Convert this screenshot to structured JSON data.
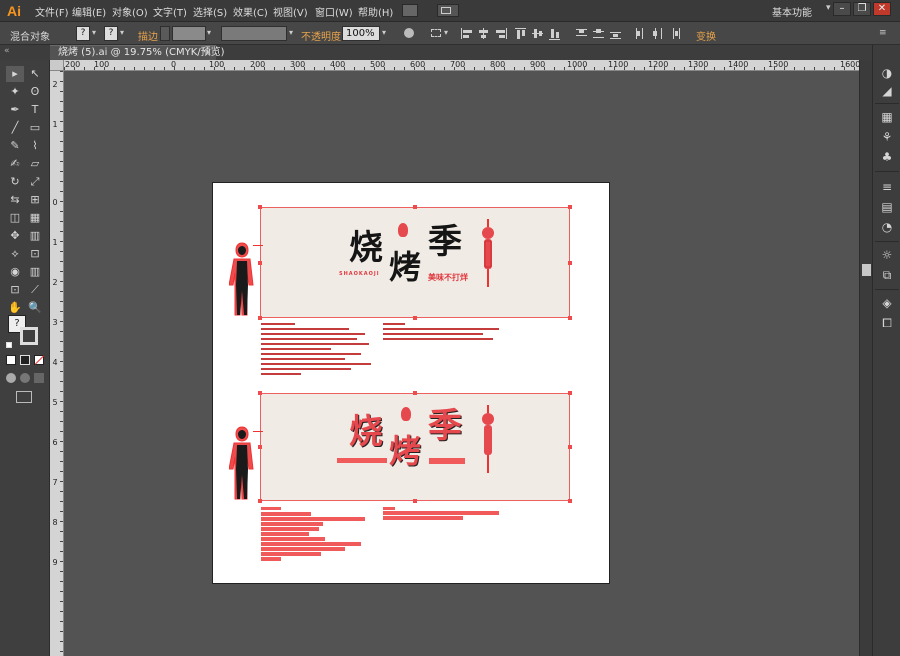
{
  "app": {
    "logo": "Ai",
    "workspace": "基本功能"
  },
  "menu": [
    "文件(F)",
    "编辑(E)",
    "对象(O)",
    "文字(T)",
    "选择(S)",
    "效果(C)",
    "视图(V)",
    "窗口(W)",
    "帮助(H)"
  ],
  "window_controls": [
    "–",
    "❐",
    "✕"
  ],
  "control_bar": {
    "object_label": "混合对象",
    "stroke_label": "描边",
    "opacity_label": "不透明度",
    "opacity_value": "100%",
    "transform_label": "变换",
    "fill_swatch": "?",
    "stroke_swatch": "?"
  },
  "document_tab": {
    "title": "烧烤 (5).ai @ 19.75% (CMYK/预览)",
    "close": "×"
  },
  "ruler": {
    "top_labels": [
      "200",
      "100",
      "0",
      "100",
      "200",
      "300",
      "400",
      "500",
      "600",
      "700",
      "800",
      "900",
      "1000",
      "1100",
      "1200",
      "1300",
      "1400",
      "1500",
      "1600"
    ],
    "left_labels": [
      "2",
      "1",
      "0",
      "1",
      "2",
      "3",
      "4",
      "5",
      "6",
      "7",
      "8",
      "9"
    ]
  },
  "tools": [
    "▸",
    "↖",
    "✒",
    "T",
    "╱",
    "▭",
    "✎",
    "⌇",
    "✍",
    "▱",
    "↻",
    "⤢",
    "⇆",
    "⊞",
    "◫",
    "▦",
    "✥",
    "▥",
    "⟡",
    "⊡",
    "✋",
    "🔍"
  ],
  "design": {
    "title_chars": [
      "烧",
      "烤",
      "季"
    ],
    "tagline": "美味不打烊",
    "pinyin": "SHAOKAOJI"
  },
  "dock_icons": [
    "palette-icon",
    "brush-icon",
    "grid-icon",
    "symbol-icon",
    "club-icon",
    "stroke-icon",
    "gradient-icon",
    "transparency-icon",
    "appearance-icon",
    "graphic-style-icon",
    "layers-icon",
    "artboards-icon"
  ],
  "colors": {
    "accent_orange": "#e7a34a",
    "design_red": "#e5484d",
    "design_bg": "#f1ebe6"
  }
}
